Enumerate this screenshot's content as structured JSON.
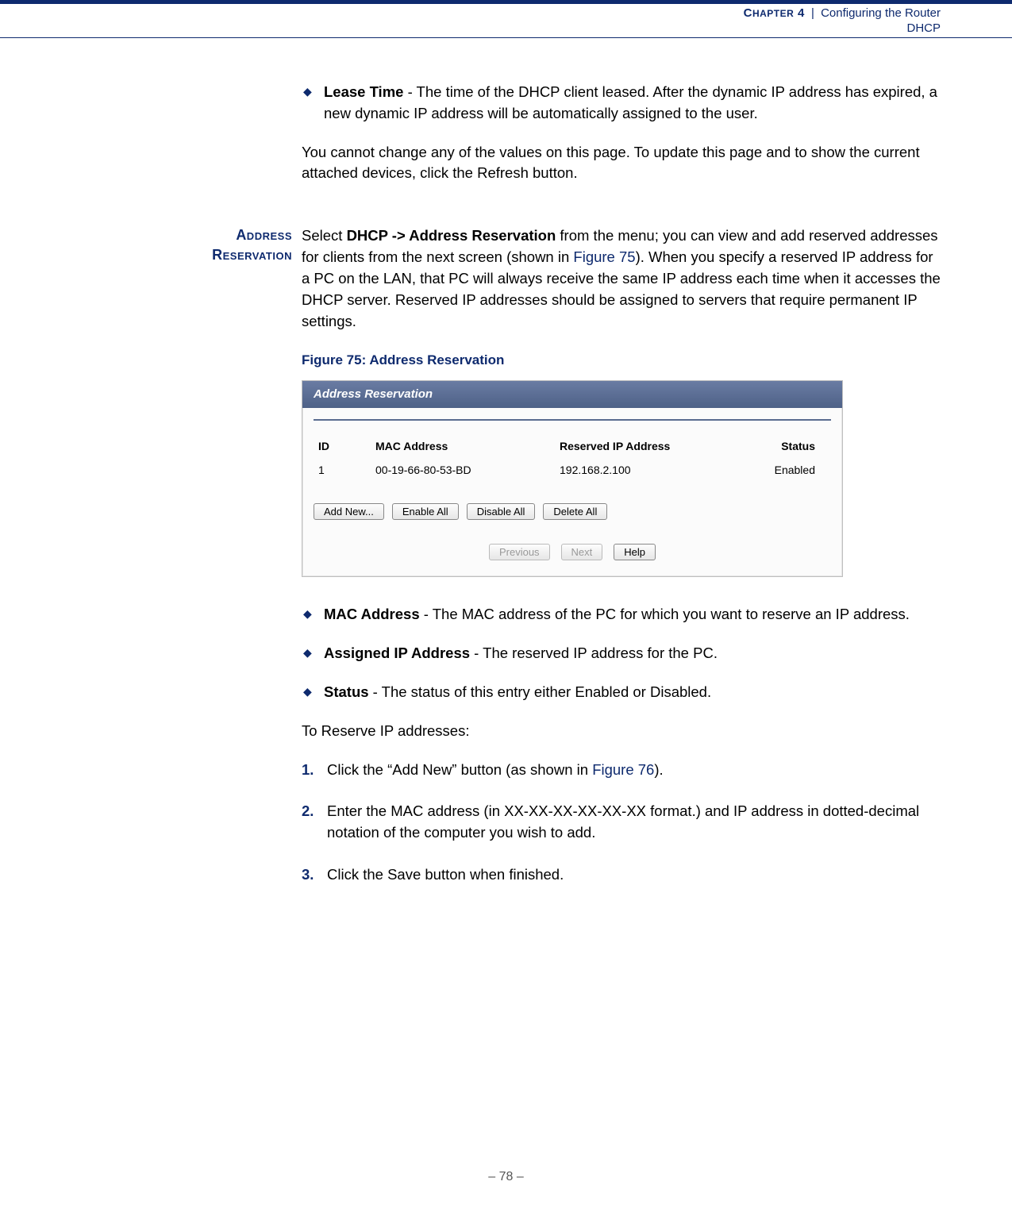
{
  "header": {
    "chapter_smallcaps_pre": "C",
    "chapter_smallcaps_rest": "HAPTER",
    "chapter_num": "4",
    "chapter_title": "Configuring the Router",
    "section": "DHCP"
  },
  "lease_block": {
    "term": "Lease Time",
    "desc": " - The time of the DHCP client leased. After the dynamic IP address has expired, a new dynamic IP address will be automatically assigned to the user."
  },
  "refresh_note": "You cannot change any of the values on this page. To update this page and to show the current attached devices, click the Refresh button.",
  "addr_res": {
    "side_label_line1": "Address",
    "side_label_line2": "Reservation",
    "intro_pre": "Select ",
    "intro_bold": "DHCP -> Address Reservation",
    "intro_mid": " from the menu; you can view and add reserved addresses for clients from the next screen (shown in ",
    "intro_figref": "Figure 75",
    "intro_post": "). When you specify a reserved IP address for a PC on the LAN, that PC will always receive the same IP address each time when it accesses the DHCP server. Reserved IP addresses should be assigned to servers that require permanent IP settings."
  },
  "figure": {
    "caption": "Figure 75:  Address Reservation",
    "panel_title": "Address Reservation",
    "columns": {
      "id": "ID",
      "mac": "MAC Address",
      "ip": "Reserved IP Address",
      "status": "Status"
    },
    "row": {
      "id": "1",
      "mac": "00-19-66-80-53-BD",
      "ip": "192.168.2.100",
      "status": "Enabled"
    },
    "buttons": {
      "add": "Add New...",
      "enable": "Enable All",
      "disable": "Disable All",
      "delete": "Delete All"
    },
    "pager": {
      "prev": "Previous",
      "next": "Next",
      "help": "Help"
    }
  },
  "bullets": {
    "mac_term": "MAC Address",
    "mac_desc": " - The MAC address of the PC for which you want to reserve an IP address.",
    "ip_term": "Assigned IP Address",
    "ip_desc": " - The reserved IP address for the PC.",
    "status_term": "Status",
    "status_desc": " - The status of this entry either Enabled or Disabled."
  },
  "steps_intro": "To Reserve IP addresses:",
  "steps": {
    "s1_pre": "Click the “Add New” button (as shown in ",
    "s1_link": "Figure 76",
    "s1_post": ").",
    "s2": "Enter the MAC address (in XX-XX-XX-XX-XX-XX format.) and IP address in dotted-decimal notation of the computer you wish to add.",
    "s3": "Click the Save button when finished."
  },
  "footer": {
    "page": "–  78  –"
  }
}
